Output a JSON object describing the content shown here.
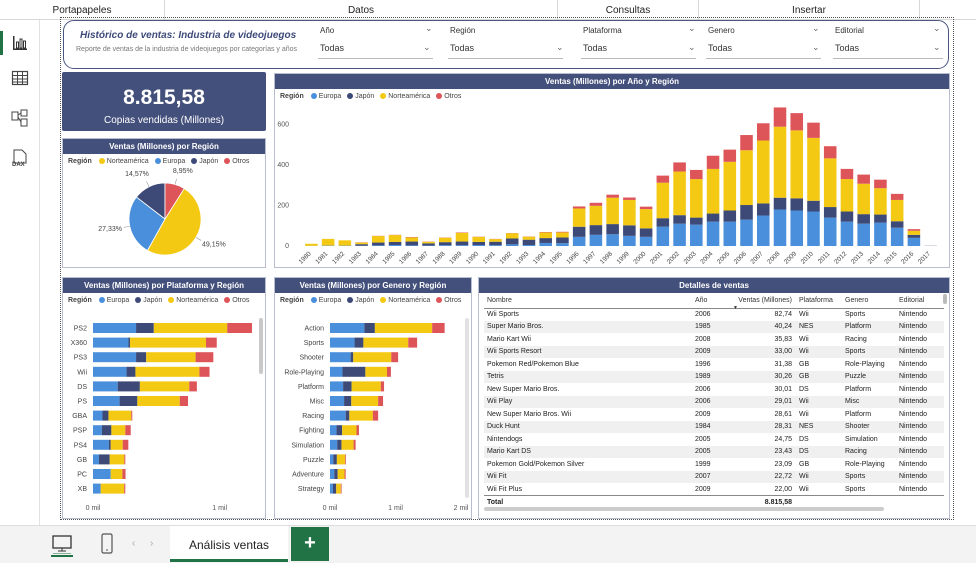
{
  "ribbon": {
    "groups": [
      "Portapapeles",
      "Datos",
      "Consultas",
      "Insertar"
    ]
  },
  "report": {
    "title": "Histórico de ventas: Industria de videojuegos",
    "subtitle": "Reporte de ventas de la industria de videojuegos por categorías y años"
  },
  "filters": [
    {
      "label": "Año",
      "value": "Todas"
    },
    {
      "label": "Región",
      "value": "Todas"
    },
    {
      "label": "Plataforma",
      "value": "Todas"
    },
    {
      "label": "Genero",
      "value": "Todas"
    },
    {
      "label": "Editorial",
      "value": "Todas"
    }
  ],
  "kpi": {
    "value": "8.815,58",
    "label": "Copias vendidas (Millones)"
  },
  "colors": {
    "europa": "#4a8fdb",
    "japon": "#3d4a78",
    "norteamerica": "#f3c913",
    "otros": "#dd5558",
    "header": "#44507c",
    "excel": "#217346"
  },
  "pie": {
    "title": "Ventas (Millones) por Región",
    "legend_title": "Región",
    "legend": [
      "Norteamérica",
      "Europa",
      "Japón",
      "Otros"
    ]
  },
  "year_chart": {
    "title": "Ventas (Millones) por Año y Región",
    "legend_title": "Región",
    "legend": [
      "Europa",
      "Japón",
      "Norteamérica",
      "Otros"
    ]
  },
  "platform_chart": {
    "title": "Ventas (Millones) por Plataforma y Región",
    "legend_title": "Región",
    "legend": [
      "Europa",
      "Japón",
      "Norteamérica",
      "Otros"
    ]
  },
  "genre_chart": {
    "title": "Ventas (Millones) por Genero y Región",
    "legend_title": "Región",
    "legend": [
      "Europa",
      "Japón",
      "Norteamérica",
      "Otros"
    ]
  },
  "table": {
    "title": "Detalles de ventas",
    "columns": [
      "Nombre",
      "Año",
      "Ventas (Millones)",
      "Plataforma",
      "Genero",
      "Editorial"
    ],
    "rows": [
      [
        "Wii Sports",
        "2006",
        "82,74",
        "Wii",
        "Sports",
        "Nintendo"
      ],
      [
        "Super Mario Bros.",
        "1985",
        "40,24",
        "NES",
        "Platform",
        "Nintendo"
      ],
      [
        "Mario Kart Wii",
        "2008",
        "35,83",
        "Wii",
        "Racing",
        "Nintendo"
      ],
      [
        "Wii Sports Resort",
        "2009",
        "33,00",
        "Wii",
        "Sports",
        "Nintendo"
      ],
      [
        "Pokemon Red/Pokemon Blue",
        "1996",
        "31,38",
        "GB",
        "Role-Playing",
        "Nintendo"
      ],
      [
        "Tetris",
        "1989",
        "30,26",
        "GB",
        "Puzzle",
        "Nintendo"
      ],
      [
        "New Super Mario Bros.",
        "2006",
        "30,01",
        "DS",
        "Platform",
        "Nintendo"
      ],
      [
        "Wii Play",
        "2006",
        "29,01",
        "Wii",
        "Misc",
        "Nintendo"
      ],
      [
        "New Super Mario Bros. Wii",
        "2009",
        "28,61",
        "Wii",
        "Platform",
        "Nintendo"
      ],
      [
        "Duck Hunt",
        "1984",
        "28,31",
        "NES",
        "Shooter",
        "Nintendo"
      ],
      [
        "Nintendogs",
        "2005",
        "24,75",
        "DS",
        "Simulation",
        "Nintendo"
      ],
      [
        "Mario Kart DS",
        "2005",
        "23,43",
        "DS",
        "Racing",
        "Nintendo"
      ],
      [
        "Pokemon Gold/Pokemon Silver",
        "1999",
        "23,09",
        "GB",
        "Role-Playing",
        "Nintendo"
      ],
      [
        "Wii Fit",
        "2007",
        "22,72",
        "Wii",
        "Sports",
        "Nintendo"
      ],
      [
        "Wii Fit Plus",
        "2009",
        "22,00",
        "Wii",
        "Sports",
        "Nintendo"
      ]
    ],
    "total_label": "Total",
    "total_value": "8.815,58"
  },
  "sheet": {
    "tab_label": "Análisis ventas",
    "add_label": "+"
  },
  "chart_data": [
    {
      "type": "pie",
      "title": "Ventas (Millones) por Región",
      "legend_title": "Región",
      "slices": [
        {
          "name": "Norteamérica",
          "value": 49.15,
          "label": "49,15%"
        },
        {
          "name": "Europa",
          "value": 27.33,
          "label": "27,33%"
        },
        {
          "name": "Japón",
          "value": 14.57,
          "label": "14,57%"
        },
        {
          "name": "Otros",
          "value": 8.95,
          "label": "8,95%"
        }
      ]
    },
    {
      "type": "bar",
      "stacked": true,
      "title": "Ventas (Millones) por Año y Región",
      "legend_title": "Región",
      "categories": [
        "1980",
        "1981",
        "1982",
        "1983",
        "1984",
        "1985",
        "1986",
        "1987",
        "1988",
        "1989",
        "1990",
        "1991",
        "1992",
        "1993",
        "1994",
        "1995",
        "1996",
        "1997",
        "1998",
        "1999",
        "2000",
        "2001",
        "2002",
        "2003",
        "2004",
        "2005",
        "2006",
        "2007",
        "2008",
        "2009",
        "2010",
        "2011",
        "2012",
        "2013",
        "2014",
        "2015",
        "2016",
        "2017"
      ],
      "series": [
        {
          "name": "Europa",
          "values": [
            1,
            2,
            2,
            1,
            3,
            5,
            3,
            2,
            4,
            4,
            5,
            4,
            8,
            5,
            15,
            14,
            45,
            55,
            58,
            50,
            45,
            95,
            110,
            105,
            120,
            120,
            130,
            150,
            180,
            175,
            170,
            140,
            120,
            110,
            115,
            90,
            40,
            0
          ]
        },
        {
          "name": "Japón",
          "values": [
            0,
            0,
            0,
            8,
            14,
            15,
            19,
            11,
            15,
            18,
            15,
            17,
            29,
            26,
            24,
            28,
            50,
            48,
            50,
            52,
            42,
            42,
            42,
            35,
            40,
            55,
            72,
            60,
            58,
            60,
            53,
            52,
            50,
            47,
            40,
            32,
            15,
            1
          ]
        },
        {
          "name": "Norteamérica",
          "values": [
            10,
            33,
            26,
            8,
            32,
            34,
            20,
            8,
            22,
            43,
            25,
            13,
            26,
            15,
            28,
            25,
            90,
            95,
            130,
            125,
            95,
            175,
            215,
            190,
            220,
            240,
            270,
            310,
            350,
            335,
            310,
            240,
            160,
            150,
            130,
            105,
            20,
            0
          ]
        },
        {
          "name": "Otros",
          "values": [
            0,
            0,
            0,
            1,
            1,
            1,
            2,
            1,
            1,
            2,
            1,
            1,
            1,
            1,
            2,
            3,
            10,
            15,
            15,
            12,
            12,
            35,
            45,
            45,
            65,
            60,
            75,
            85,
            95,
            85,
            75,
            60,
            50,
            45,
            42,
            30,
            8,
            0
          ]
        }
      ],
      "ylim": [
        0,
        700
      ],
      "yticks": [
        0,
        200,
        400,
        600
      ]
    },
    {
      "type": "bar",
      "orientation": "horizontal",
      "stacked": true,
      "title": "Ventas (Millones) por Plataforma y Región",
      "legend_title": "Región",
      "categories": [
        "PS2",
        "X360",
        "PS3",
        "Wii",
        "DS",
        "PS",
        "GBA",
        "PSP",
        "PS4",
        "GB",
        "PC",
        "XB"
      ],
      "series": [
        {
          "name": "Europa",
          "values": [
            340,
            280,
            340,
            265,
            195,
            210,
            75,
            70,
            125,
            47,
            140,
            60
          ]
        },
        {
          "name": "Japón",
          "values": [
            140,
            12,
            80,
            70,
            175,
            140,
            47,
            75,
            15,
            85,
            0,
            1
          ]
        },
        {
          "name": "Norteamérica",
          "values": [
            580,
            600,
            390,
            505,
            390,
            335,
            180,
            110,
            95,
            115,
            92,
            185
          ]
        },
        {
          "name": "Otros",
          "values": [
            195,
            85,
            140,
            80,
            60,
            65,
            8,
            43,
            44,
            8,
            25,
            9
          ]
        }
      ],
      "xticks": [
        "0 mil",
        "1 mil"
      ],
      "xlim": [
        0,
        1500
      ]
    },
    {
      "type": "bar",
      "orientation": "horizontal",
      "stacked": true,
      "title": "Ventas (Millones) por Genero y Región",
      "legend_title": "Región",
      "categories": [
        "Action",
        "Sports",
        "Shooter",
        "Role-Playing",
        "Platform",
        "Misc",
        "Racing",
        "Fighting",
        "Simulation",
        "Puzzle",
        "Adventure",
        "Strategy"
      ],
      "series": [
        {
          "name": "Europa",
          "values": [
            525,
            375,
            315,
            190,
            200,
            215,
            240,
            100,
            110,
            50,
            65,
            45
          ]
        },
        {
          "name": "Japón",
          "values": [
            160,
            135,
            40,
            350,
            130,
            110,
            55,
            85,
            65,
            55,
            52,
            50
          ]
        },
        {
          "name": "Norteamérica",
          "values": [
            875,
            685,
            580,
            330,
            445,
            410,
            360,
            220,
            185,
            125,
            105,
            70
          ]
        },
        {
          "name": "Otros",
          "values": [
            190,
            135,
            105,
            60,
            50,
            75,
            80,
            37,
            31,
            12,
            17,
            12
          ]
        }
      ],
      "xticks": [
        "0 mil",
        "1 mil",
        "2 mil"
      ],
      "xlim": [
        0,
        2000
      ]
    }
  ]
}
